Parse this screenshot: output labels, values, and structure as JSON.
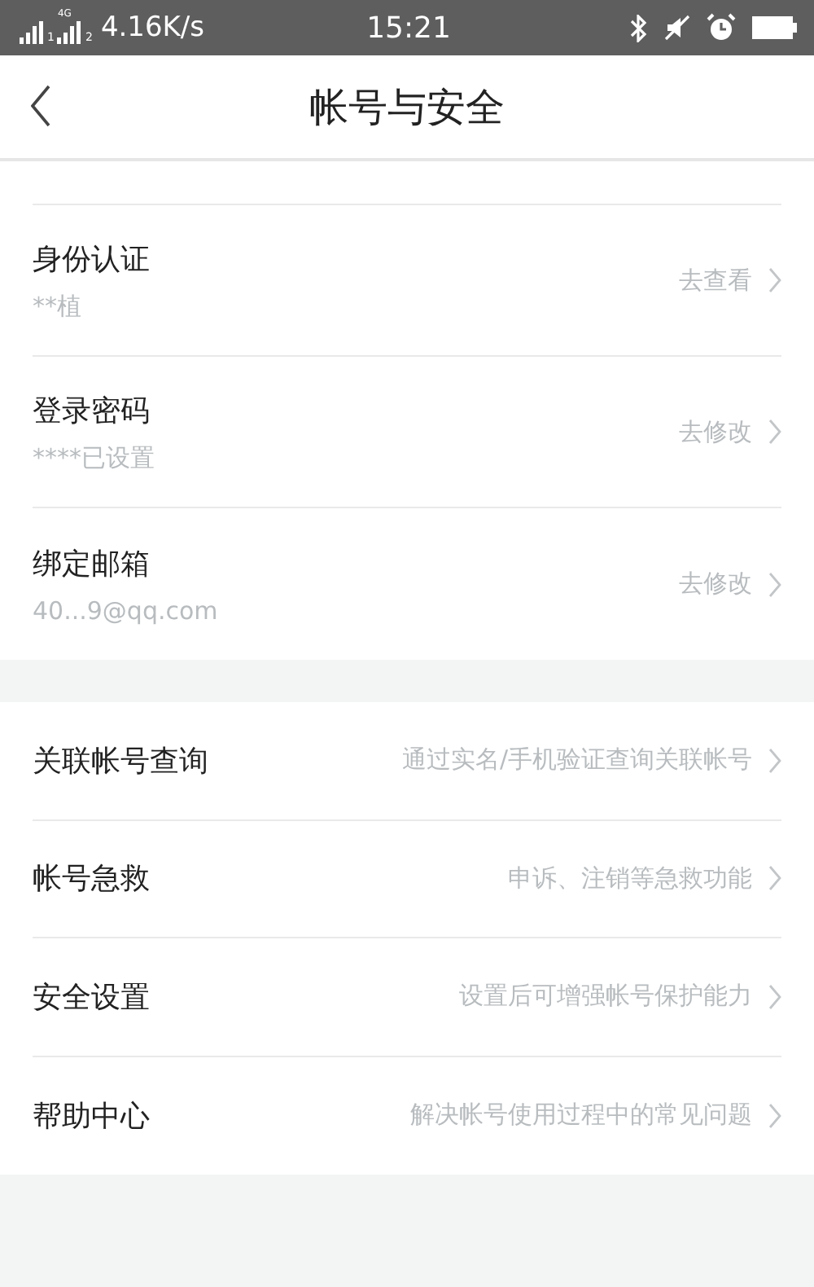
{
  "status_bar": {
    "sims": [
      {
        "slot": "1"
      },
      {
        "slot": "2",
        "network": "4G"
      }
    ],
    "speed": "4.16K/s",
    "time": "15:21"
  },
  "header": {
    "title": "帐号与安全"
  },
  "account_items": [
    {
      "title": "身份认证",
      "value": "**植",
      "action": "去查看"
    },
    {
      "title": "登录密码",
      "value": "****已设置",
      "action": "去修改"
    },
    {
      "title": "绑定邮箱",
      "value": "40...9@qq.com",
      "action": "去修改"
    }
  ],
  "link_items": [
    {
      "title": "关联帐号查询",
      "hint": "通过实名/手机验证查询关联帐号"
    },
    {
      "title": "帐号急救",
      "hint": "申诉、注销等急救功能"
    },
    {
      "title": "安全设置",
      "hint": "设置后可增强帐号保护能力"
    },
    {
      "title": "帮助中心",
      "hint": "解决帐号使用过程中的常见问题"
    }
  ]
}
